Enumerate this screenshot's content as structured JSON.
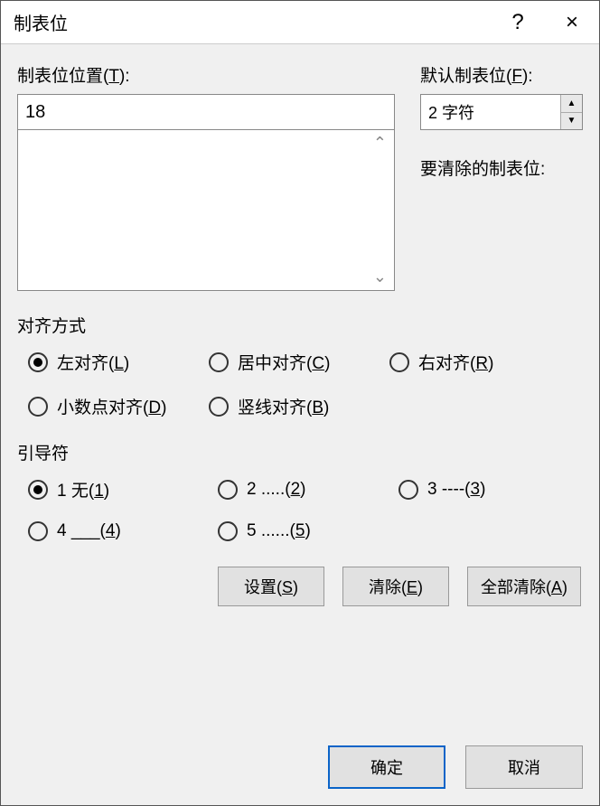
{
  "title": "制表位",
  "help_symbol": "?",
  "close_symbol": "×",
  "labels": {
    "tab_position": "制表位位置",
    "tab_position_mn": "T",
    "default_tab": "默认制表位",
    "default_tab_mn": "F",
    "to_clear": "要清除的制表位:"
  },
  "tab_position_value": "18",
  "default_tab_value": "2 字符",
  "sections": {
    "alignment": "对齐方式",
    "leader": "引导符"
  },
  "alignment": {
    "selected": "left",
    "options": {
      "left": {
        "label": "左对齐",
        "mn": "L"
      },
      "center": {
        "label": "居中对齐",
        "mn": "C"
      },
      "right": {
        "label": "右对齐",
        "mn": "R"
      },
      "decimal": {
        "label": "小数点对齐",
        "mn": "D"
      },
      "bar": {
        "label": "竖线对齐",
        "mn": "B"
      }
    }
  },
  "leader": {
    "selected": "1",
    "options": {
      "1": {
        "label": "1 无",
        "mn": "1"
      },
      "2": {
        "label": "2 .....",
        "mn": "2"
      },
      "3": {
        "label": "3 ----",
        "mn": "3"
      },
      "4": {
        "label": "4 ___",
        "mn": "4"
      },
      "5": {
        "label": "5 ......",
        "mn": "5"
      }
    }
  },
  "buttons": {
    "set": {
      "label": "设置",
      "mn": "S"
    },
    "clear": {
      "label": "清除",
      "mn": "E"
    },
    "clear_all": {
      "label": "全部清除",
      "mn": "A"
    },
    "ok": "确定",
    "cancel": "取消"
  }
}
